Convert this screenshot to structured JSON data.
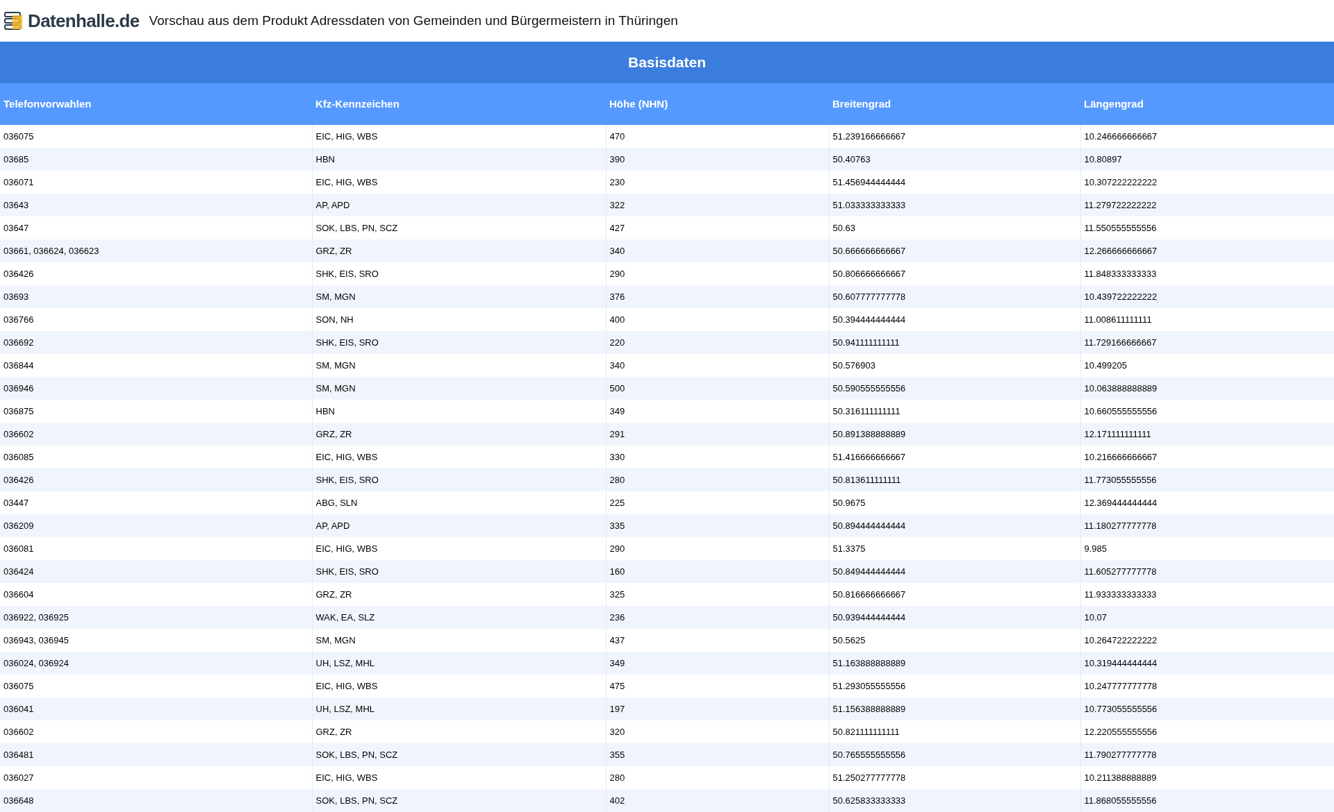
{
  "header": {
    "logo_text": "Datenhalle.de",
    "title": "Vorschau aus dem Produkt Adressdaten von Gemeinden und Bürgermeistern in Thüringen"
  },
  "table": {
    "caption": "Basisdaten",
    "columns": [
      "Telefonvorwahlen",
      "Kfz-Kennzeichen",
      "Höhe (NHN)",
      "Breitengrad",
      "Längengrad"
    ],
    "rows": [
      [
        "036075",
        "EIC, HIG, WBS",
        "470",
        "51.239166666667",
        "10.246666666667"
      ],
      [
        "03685",
        "HBN",
        "390",
        "50.40763",
        "10.80897"
      ],
      [
        "036071",
        "EIC, HIG, WBS",
        "230",
        "51.456944444444",
        "10.307222222222"
      ],
      [
        "03643",
        "AP, APD",
        "322",
        "51.033333333333",
        "11.279722222222"
      ],
      [
        "03647",
        "SOK, LBS, PN, SCZ",
        "427",
        "50.63",
        "11.550555555556"
      ],
      [
        "03661, 036624, 036623",
        "GRZ, ZR",
        "340",
        "50.666666666667",
        "12.266666666667"
      ],
      [
        "036426",
        "SHK, EIS, SRO",
        "290",
        "50.806666666667",
        "11.848333333333"
      ],
      [
        "03693",
        "SM, MGN",
        "376",
        "50.607777777778",
        "10.439722222222"
      ],
      [
        "036766",
        "SON, NH",
        "400",
        "50.394444444444",
        "11.008611111111"
      ],
      [
        "036692",
        "SHK, EIS, SRO",
        "220",
        "50.941111111111",
        "11.729166666667"
      ],
      [
        "036844",
        "SM, MGN",
        "340",
        "50.576903",
        "10.499205"
      ],
      [
        "036946",
        "SM, MGN",
        "500",
        "50.590555555556",
        "10.063888888889"
      ],
      [
        "036875",
        "HBN",
        "349",
        "50.316111111111",
        "10.660555555556"
      ],
      [
        "036602",
        "GRZ, ZR",
        "291",
        "50.891388888889",
        "12.171111111111"
      ],
      [
        "036085",
        "EIC, HIG, WBS",
        "330",
        "51.416666666667",
        "10.216666666667"
      ],
      [
        "036426",
        "SHK, EIS, SRO",
        "280",
        "50.813611111111",
        "11.773055555556"
      ],
      [
        "03447",
        "ABG, SLN",
        "225",
        "50.9675",
        "12.369444444444"
      ],
      [
        "036209",
        "AP, APD",
        "335",
        "50.894444444444",
        "11.180277777778"
      ],
      [
        "036081",
        "EIC, HIG, WBS",
        "290",
        "51.3375",
        "9.985"
      ],
      [
        "036424",
        "SHK, EIS, SRO",
        "160",
        "50.849444444444",
        "11.605277777778"
      ],
      [
        "036604",
        "GRZ, ZR",
        "325",
        "50.816666666667",
        "11.933333333333"
      ],
      [
        "036922, 036925",
        "WAK, EA, SLZ",
        "236",
        "50.939444444444",
        "10.07"
      ],
      [
        "036943, 036945",
        "SM, MGN",
        "437",
        "50.5625",
        "10.264722222222"
      ],
      [
        "036024, 036924",
        "UH, LSZ, MHL",
        "349",
        "51.163888888889",
        "10.319444444444"
      ],
      [
        "036075",
        "EIC, HIG, WBS",
        "475",
        "51.293055555556",
        "10.247777777778"
      ],
      [
        "036041",
        "UH, LSZ, MHL",
        "197",
        "51.156388888889",
        "10.773055555556"
      ],
      [
        "036602",
        "GRZ, ZR",
        "320",
        "50.821111111111",
        "12.220555555556"
      ],
      [
        "036481",
        "SOK, LBS, PN, SCZ",
        "355",
        "50.765555555556",
        "11.790277777778"
      ],
      [
        "036027",
        "EIC, HIG, WBS",
        "280",
        "51.250277777778",
        "10.211388888889"
      ],
      [
        "036648",
        "SOK, LBS, PN, SCZ",
        "402",
        "50.625833333333",
        "11.868055555556"
      ]
    ]
  }
}
